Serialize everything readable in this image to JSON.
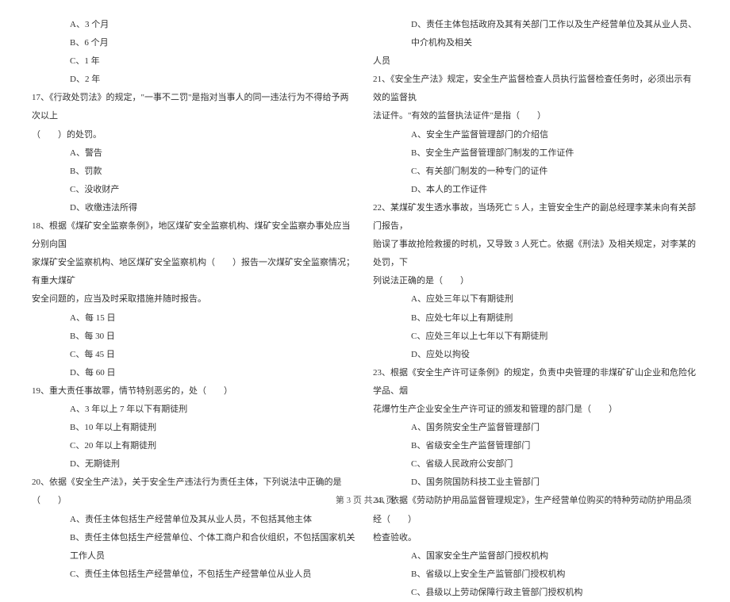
{
  "left_column": {
    "lines": [
      {
        "cls": "option-line",
        "text": "A、3 个月"
      },
      {
        "cls": "option-line",
        "text": "B、6 个月"
      },
      {
        "cls": "option-line",
        "text": "C、1 年"
      },
      {
        "cls": "option-line",
        "text": "D、2 年"
      },
      {
        "cls": "question-line",
        "text": "17、《行政处罚法》的规定，\"一事不二罚\"是指对当事人的同一违法行为不得给予两次以上"
      },
      {
        "cls": "continuation-line",
        "text": "（　　）的处罚。"
      },
      {
        "cls": "option-line",
        "text": "A、警告"
      },
      {
        "cls": "option-line",
        "text": "B、罚款"
      },
      {
        "cls": "option-line",
        "text": "C、没收财产"
      },
      {
        "cls": "option-line",
        "text": "D、收缴违法所得"
      },
      {
        "cls": "question-line",
        "text": "18、根据《煤矿安全监察条例》，地区煤矿安全监察机构、煤矿安全监察办事处应当分别向国"
      },
      {
        "cls": "continuation-line",
        "text": "家煤矿安全监察机构、地区煤矿安全监察机构（　　）报告一次煤矿安全监察情况；有重大煤矿"
      },
      {
        "cls": "continuation-line",
        "text": "安全问题的，应当及时采取措施并随时报告。"
      },
      {
        "cls": "option-line",
        "text": "A、每 15 日"
      },
      {
        "cls": "option-line",
        "text": "B、每 30 日"
      },
      {
        "cls": "option-line",
        "text": "C、每 45 日"
      },
      {
        "cls": "option-line",
        "text": "D、每 60 日"
      },
      {
        "cls": "question-line",
        "text": "19、重大责任事故罪，情节特别恶劣的，处（　　）"
      },
      {
        "cls": "option-line",
        "text": "A、3 年以上 7 年以下有期徒刑"
      },
      {
        "cls": "option-line",
        "text": "B、10 年以上有期徒刑"
      },
      {
        "cls": "option-line",
        "text": "C、20 年以上有期徒刑"
      },
      {
        "cls": "option-line",
        "text": "D、无期徒刑"
      },
      {
        "cls": "question-line",
        "text": "20、依据《安全生产法》，关于安全生产违法行为责任主体，下列说法中正确的是（　　）"
      },
      {
        "cls": "option-line",
        "text": "A、责任主体包括生产经营单位及其从业人员，不包括其他主体"
      },
      {
        "cls": "option-line",
        "text": "B、责任主体包括生产经营单位、个体工商户和合伙组织，不包括国家机关工作人员"
      },
      {
        "cls": "option-line",
        "text": "C、责任主体包括生产经营单位，不包括生产经营单位从业人员"
      }
    ]
  },
  "right_column": {
    "lines": [
      {
        "cls": "option-line",
        "text": "D、责任主体包括政府及其有关部门工作以及生产经营单位及其从业人员、中介机构及相关"
      },
      {
        "cls": "continuation-line",
        "text": "人员"
      },
      {
        "cls": "question-line",
        "text": "21、《安全生产法》规定，安全生产监督检查人员执行监督检查任务时，必须出示有效的监督执"
      },
      {
        "cls": "continuation-line",
        "text": "法证件。\"有效的监督执法证件\"是指（　　）"
      },
      {
        "cls": "option-line",
        "text": "A、安全生产监督管理部门的介绍信"
      },
      {
        "cls": "option-line",
        "text": "B、安全生产监督管理部门制发的工作证件"
      },
      {
        "cls": "option-line",
        "text": "C、有关部门制发的一种专门的证件"
      },
      {
        "cls": "option-line",
        "text": "D、本人的工作证件"
      },
      {
        "cls": "question-line",
        "text": "22、某煤矿发生透水事故，当场死亡 5 人，主管安全生产的副总经理李某未向有关部门报告，"
      },
      {
        "cls": "continuation-line",
        "text": "贻误了事故抢险救援的时机，又导致 3 人死亡。依据《刑法》及相关规定，对李某的处罚，下"
      },
      {
        "cls": "continuation-line",
        "text": "列说法正确的是（　　）"
      },
      {
        "cls": "option-line",
        "text": "A、应处三年以下有期徒刑"
      },
      {
        "cls": "option-line",
        "text": "B、应处七年以上有期徒刑"
      },
      {
        "cls": "option-line",
        "text": "C、应处三年以上七年以下有期徒刑"
      },
      {
        "cls": "option-line",
        "text": "D、应处以拘役"
      },
      {
        "cls": "question-line",
        "text": "23、根据《安全生产许可证条例》的规定，负责中央管理的非煤矿矿山企业和危险化学品、烟"
      },
      {
        "cls": "continuation-line",
        "text": "花爆竹生产企业安全生产许可证的颁发和管理的部门是（　　）"
      },
      {
        "cls": "option-line",
        "text": "A、国务院安全生产监督管理部门"
      },
      {
        "cls": "option-line",
        "text": "B、省级安全生产监督管理部门"
      },
      {
        "cls": "option-line",
        "text": "C、省级人民政府公安部门"
      },
      {
        "cls": "option-line",
        "text": "D、国务院国防科技工业主管部门"
      },
      {
        "cls": "question-line",
        "text": "24、依据《劳动防护用品监督管理规定》，生产经营单位购买的特种劳动防护用品须经（　　）"
      },
      {
        "cls": "continuation-line",
        "text": "检查验收。"
      },
      {
        "cls": "option-line",
        "text": "A、国家安全生产监督部门授权机构"
      },
      {
        "cls": "option-line",
        "text": "B、省级以上安全生产监管部门授权机构"
      },
      {
        "cls": "option-line",
        "text": "C、县级以上劳动保障行政主管部门授权机构"
      }
    ]
  },
  "footer_text": "第 3 页 共 13 页"
}
